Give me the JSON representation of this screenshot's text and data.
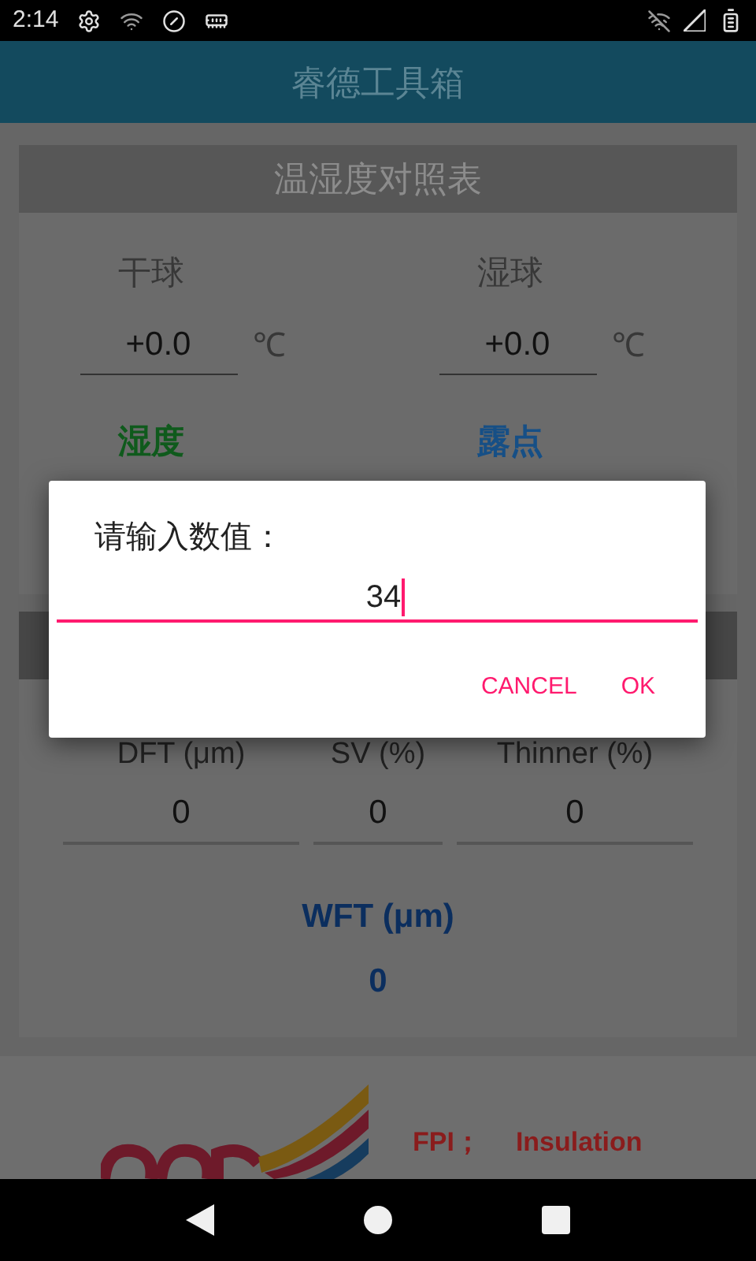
{
  "status_bar": {
    "time": "2:14"
  },
  "app_bar": {
    "title": "睿德工具箱"
  },
  "humidity_card": {
    "title": "温湿度对照表",
    "inputs": [
      {
        "label": "干球",
        "value": "+0.0",
        "unit": "℃"
      },
      {
        "label": "湿球",
        "value": "+0.0",
        "unit": "℃"
      }
    ],
    "results": [
      {
        "label": "湿度",
        "kind": "humidity"
      },
      {
        "label": "露点",
        "kind": "dew_point"
      }
    ]
  },
  "film_card": {
    "inputs": [
      {
        "label": "DFT (μm)",
        "value": "0"
      },
      {
        "label": "SV (%)",
        "value": "0"
      },
      {
        "label": "Thinner (%)",
        "value": "0"
      }
    ],
    "result": {
      "label": "WFT (μm)",
      "value": "0"
    }
  },
  "footer": {
    "texts": [
      "FPI；",
      "Insulation"
    ]
  },
  "dialog": {
    "message": "请输入数值：",
    "value": "34",
    "buttons": [
      "CANCEL",
      "OK"
    ]
  }
}
